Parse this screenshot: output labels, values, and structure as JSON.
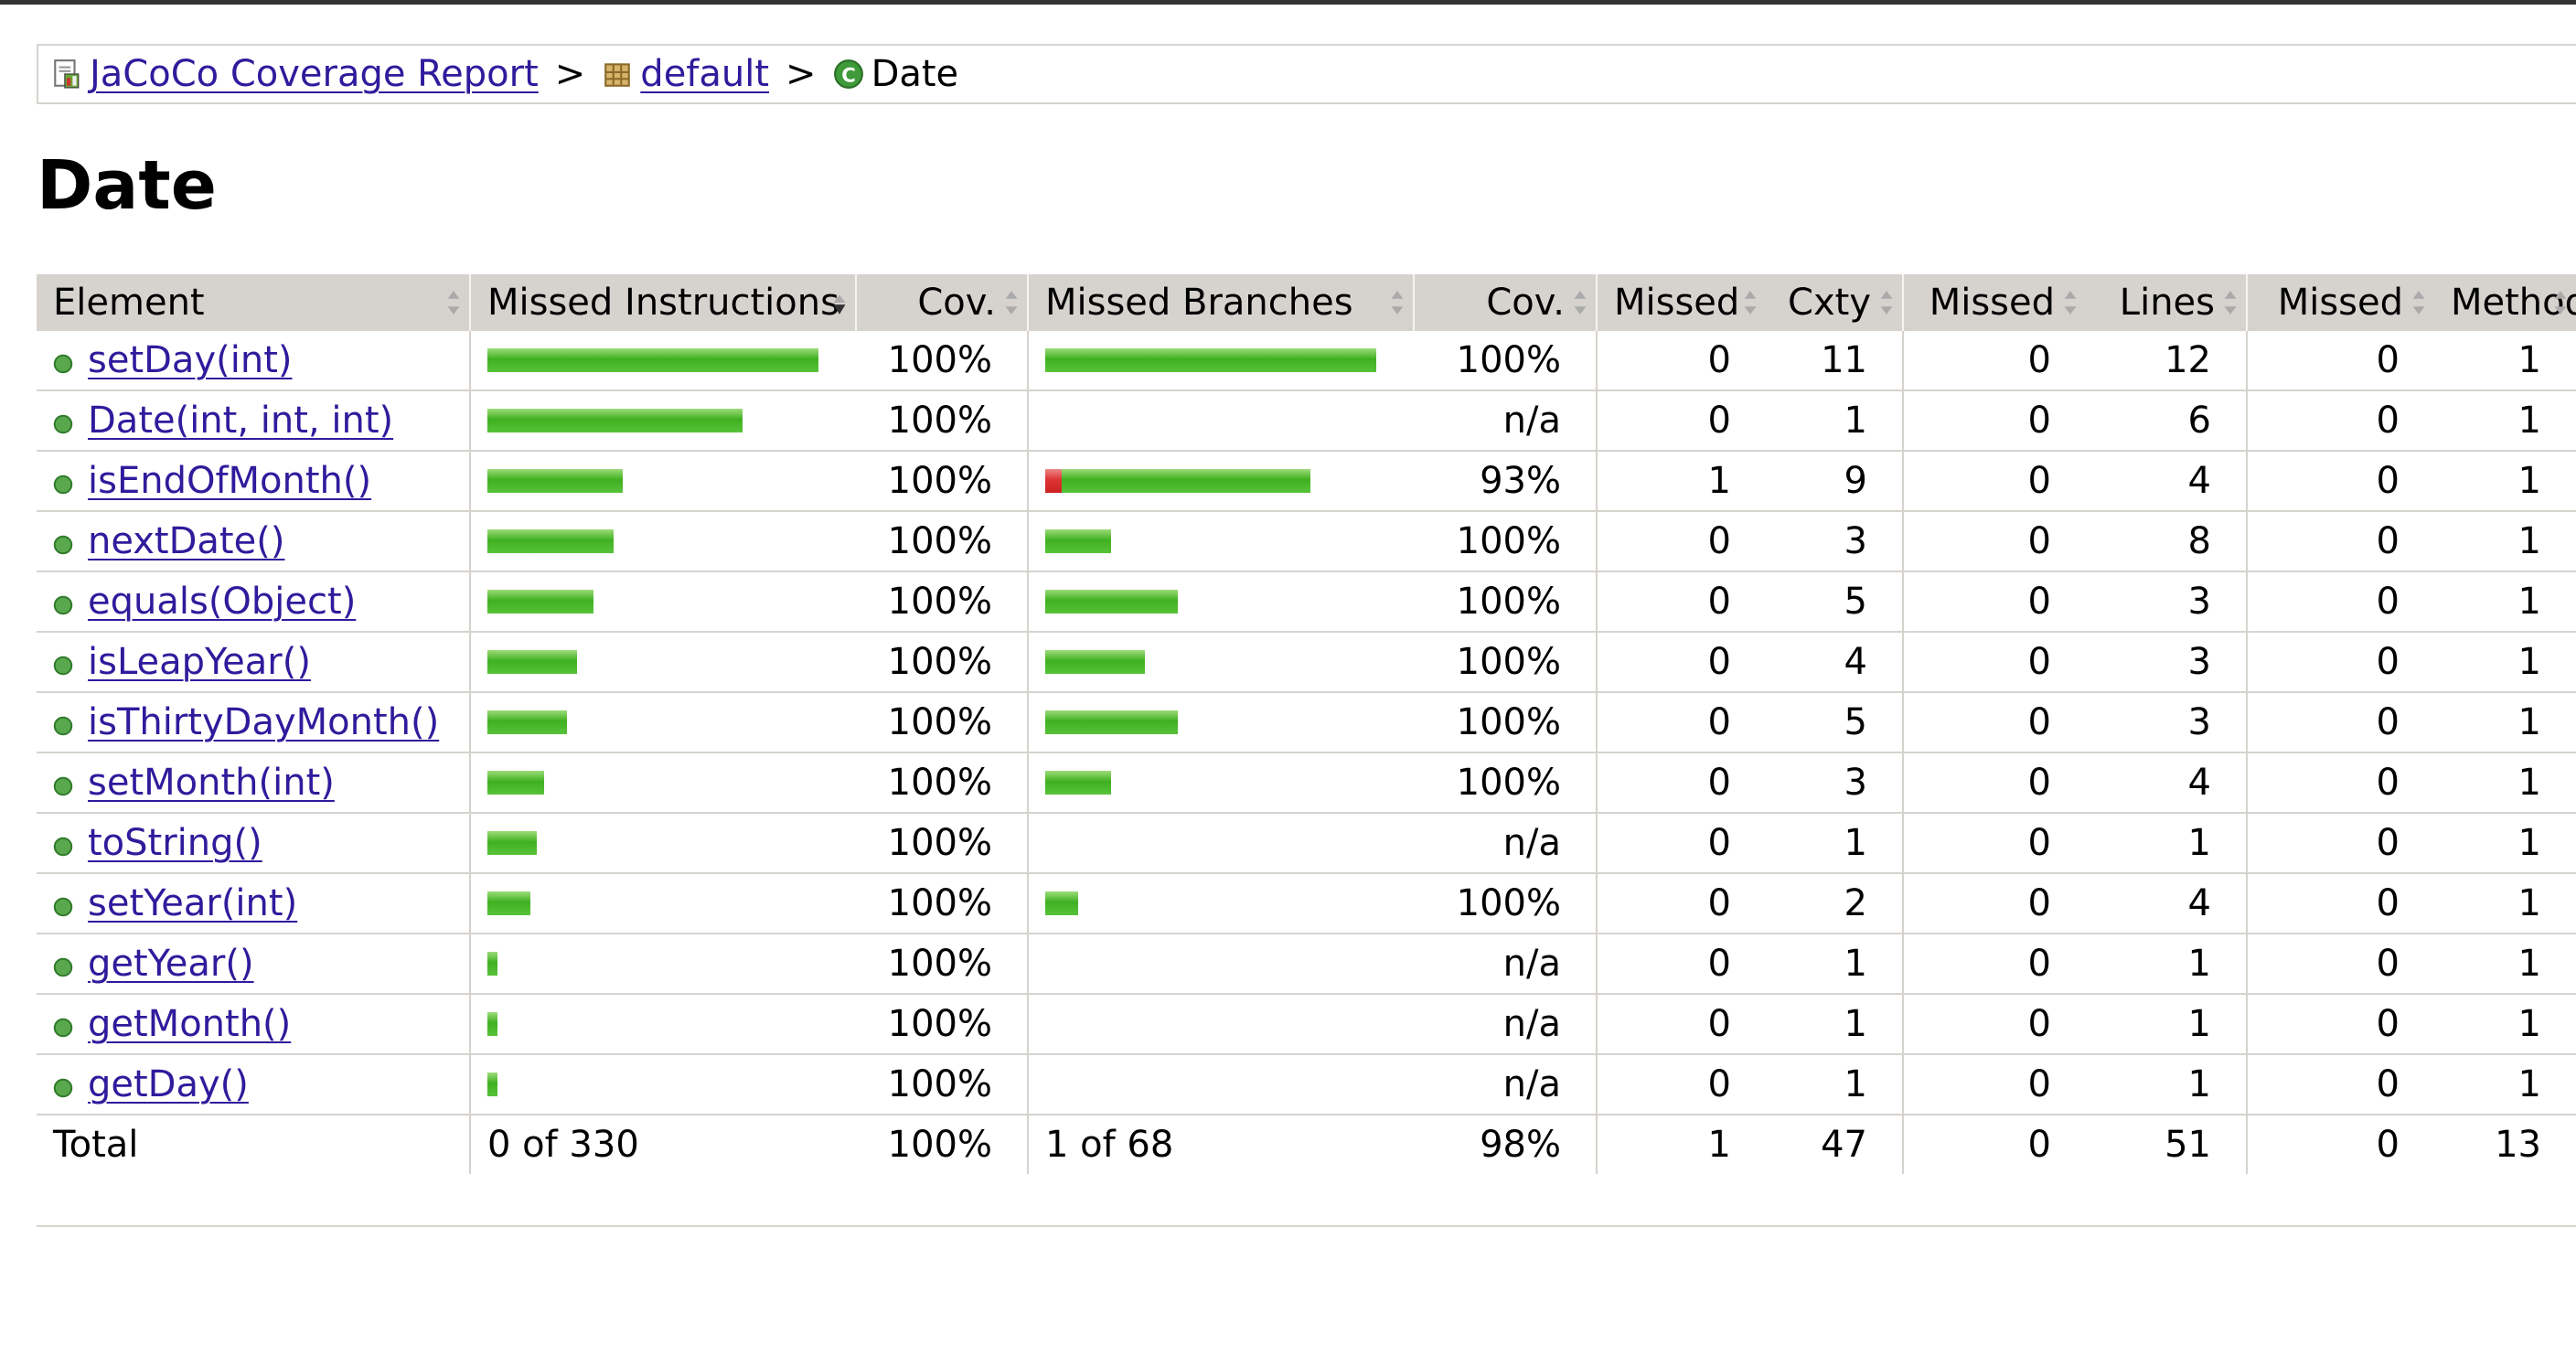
{
  "breadcrumb": {
    "report": "JaCoCo Coverage Report",
    "package": "default",
    "current": "Date",
    "separator": ">"
  },
  "title": "Date",
  "colors": {
    "link": "#2f1b9c",
    "header_bg": "#d6d3ce",
    "bar_green": "#3fb020",
    "bar_red": "#d33333"
  },
  "table": {
    "columns": [
      "Element",
      "Missed Instructions",
      "Cov.",
      "Missed Branches",
      "Cov.",
      "Missed",
      "Cxty",
      "Missed",
      "Lines",
      "Missed",
      "Methods"
    ],
    "rows": [
      {
        "name": "setDay(int)",
        "instr_cov": "100%",
        "instr_frac": 1.0,
        "instr_missed_frac": 0,
        "br_cov": "100%",
        "br_frac": 1.0,
        "br_missed_frac": 0,
        "cx_missed": "0",
        "cxty": "11",
        "lines_missed": "0",
        "lines": "12",
        "meth_missed": "0",
        "methods": "1"
      },
      {
        "name": "Date(int, int, int)",
        "instr_cov": "100%",
        "instr_frac": 0.77,
        "instr_missed_frac": 0,
        "br_cov": "n/a",
        "br_frac": 0,
        "br_missed_frac": 0,
        "cx_missed": "0",
        "cxty": "1",
        "lines_missed": "0",
        "lines": "6",
        "meth_missed": "0",
        "methods": "1"
      },
      {
        "name": "isEndOfMonth()",
        "instr_cov": "100%",
        "instr_frac": 0.41,
        "instr_missed_frac": 0,
        "br_cov": "93%",
        "br_frac": 0.75,
        "br_missed_frac": 0.05,
        "cx_missed": "1",
        "cxty": "9",
        "lines_missed": "0",
        "lines": "4",
        "meth_missed": "0",
        "methods": "1"
      },
      {
        "name": "nextDate()",
        "instr_cov": "100%",
        "instr_frac": 0.38,
        "instr_missed_frac": 0,
        "br_cov": "100%",
        "br_frac": 0.2,
        "br_missed_frac": 0,
        "cx_missed": "0",
        "cxty": "3",
        "lines_missed": "0",
        "lines": "8",
        "meth_missed": "0",
        "methods": "1"
      },
      {
        "name": "equals(Object)",
        "instr_cov": "100%",
        "instr_frac": 0.32,
        "instr_missed_frac": 0,
        "br_cov": "100%",
        "br_frac": 0.4,
        "br_missed_frac": 0,
        "cx_missed": "0",
        "cxty": "5",
        "lines_missed": "0",
        "lines": "3",
        "meth_missed": "0",
        "methods": "1"
      },
      {
        "name": "isLeapYear()",
        "instr_cov": "100%",
        "instr_frac": 0.27,
        "instr_missed_frac": 0,
        "br_cov": "100%",
        "br_frac": 0.3,
        "br_missed_frac": 0,
        "cx_missed": "0",
        "cxty": "4",
        "lines_missed": "0",
        "lines": "3",
        "meth_missed": "0",
        "methods": "1"
      },
      {
        "name": "isThirtyDayMonth()",
        "instr_cov": "100%",
        "instr_frac": 0.24,
        "instr_missed_frac": 0,
        "br_cov": "100%",
        "br_frac": 0.4,
        "br_missed_frac": 0,
        "cx_missed": "0",
        "cxty": "5",
        "lines_missed": "0",
        "lines": "3",
        "meth_missed": "0",
        "methods": "1"
      },
      {
        "name": "setMonth(int)",
        "instr_cov": "100%",
        "instr_frac": 0.17,
        "instr_missed_frac": 0,
        "br_cov": "100%",
        "br_frac": 0.2,
        "br_missed_frac": 0,
        "cx_missed": "0",
        "cxty": "3",
        "lines_missed": "0",
        "lines": "4",
        "meth_missed": "0",
        "methods": "1"
      },
      {
        "name": "toString()",
        "instr_cov": "100%",
        "instr_frac": 0.15,
        "instr_missed_frac": 0,
        "br_cov": "n/a",
        "br_frac": 0,
        "br_missed_frac": 0,
        "cx_missed": "0",
        "cxty": "1",
        "lines_missed": "0",
        "lines": "1",
        "meth_missed": "0",
        "methods": "1"
      },
      {
        "name": "setYear(int)",
        "instr_cov": "100%",
        "instr_frac": 0.13,
        "instr_missed_frac": 0,
        "br_cov": "100%",
        "br_frac": 0.1,
        "br_missed_frac": 0,
        "cx_missed": "0",
        "cxty": "2",
        "lines_missed": "0",
        "lines": "4",
        "meth_missed": "0",
        "methods": "1"
      },
      {
        "name": "getYear()",
        "instr_cov": "100%",
        "instr_frac": 0.03,
        "instr_missed_frac": 0,
        "br_cov": "n/a",
        "br_frac": 0,
        "br_missed_frac": 0,
        "cx_missed": "0",
        "cxty": "1",
        "lines_missed": "0",
        "lines": "1",
        "meth_missed": "0",
        "methods": "1"
      },
      {
        "name": "getMonth()",
        "instr_cov": "100%",
        "instr_frac": 0.03,
        "instr_missed_frac": 0,
        "br_cov": "n/a",
        "br_frac": 0,
        "br_missed_frac": 0,
        "cx_missed": "0",
        "cxty": "1",
        "lines_missed": "0",
        "lines": "1",
        "meth_missed": "0",
        "methods": "1"
      },
      {
        "name": "getDay()",
        "instr_cov": "100%",
        "instr_frac": 0.03,
        "instr_missed_frac": 0,
        "br_cov": "n/a",
        "br_frac": 0,
        "br_missed_frac": 0,
        "cx_missed": "0",
        "cxty": "1",
        "lines_missed": "0",
        "lines": "1",
        "meth_missed": "0",
        "methods": "1"
      }
    ],
    "total": {
      "label": "Total",
      "instr": "0 of 330",
      "instr_cov": "100%",
      "br": "1 of 68",
      "br_cov": "98%",
      "cx_missed": "1",
      "cxty": "47",
      "lines_missed": "0",
      "lines": "51",
      "meth_missed": "0",
      "methods": "13"
    }
  }
}
